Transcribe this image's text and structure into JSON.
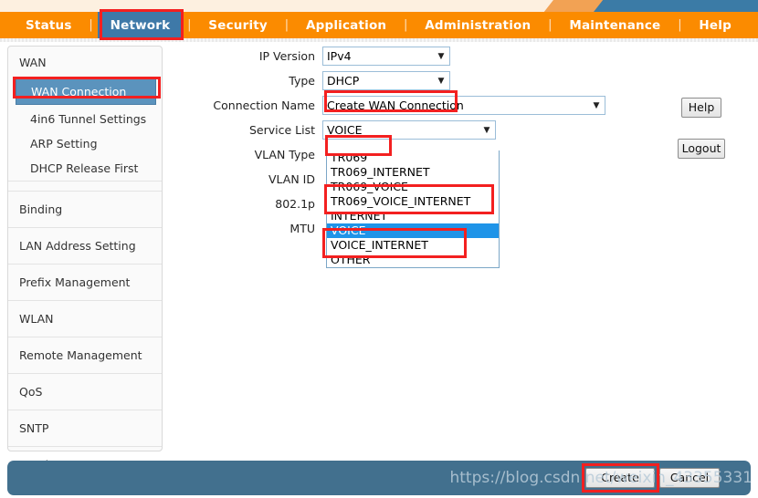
{
  "nav": {
    "separator": "|",
    "items": [
      {
        "label": "Status",
        "active": false
      },
      {
        "label": "Network",
        "active": true
      },
      {
        "label": "Security",
        "active": false
      },
      {
        "label": "Application",
        "active": false
      },
      {
        "label": "Administration",
        "active": false
      },
      {
        "label": "Maintenance",
        "active": false
      },
      {
        "label": "Help",
        "active": false
      }
    ]
  },
  "sidebar": {
    "group_title": "WAN",
    "sub_items": [
      {
        "label": "WAN Connection",
        "selected": true
      },
      {
        "label": "4in6 Tunnel Settings",
        "selected": false
      },
      {
        "label": "ARP Setting",
        "selected": false
      },
      {
        "label": "DHCP Release First",
        "selected": false
      }
    ],
    "items": [
      {
        "label": "Binding"
      },
      {
        "label": "LAN Address Setting"
      },
      {
        "label": "Prefix Management"
      },
      {
        "label": "WLAN"
      },
      {
        "label": "Remote Management"
      },
      {
        "label": "QoS"
      },
      {
        "label": "SNTP"
      },
      {
        "label": "Routing"
      }
    ]
  },
  "form": {
    "ip_version": {
      "label": "IP Version",
      "value": "IPv4"
    },
    "type": {
      "label": "Type",
      "value": "DHCP"
    },
    "connection_name": {
      "label": "Connection Name",
      "value": "Create WAN Connection"
    },
    "service_list": {
      "label": "Service List",
      "value": "VOICE"
    },
    "vlan_type": {
      "label": "VLAN Type"
    },
    "vlan_id": {
      "label": "VLAN ID"
    },
    "dot1p": {
      "label": "802.1p"
    },
    "mtu": {
      "label": "MTU"
    }
  },
  "dropdown": {
    "open": true,
    "options": [
      {
        "label": "TR069",
        "selected": false
      },
      {
        "label": "TR069_INTERNET",
        "selected": false
      },
      {
        "label": "TR069_VOICE",
        "selected": false
      },
      {
        "label": "TR069_VOICE_INTERNET",
        "selected": false
      },
      {
        "label": "INTERNET",
        "selected": false
      },
      {
        "label": "VOICE",
        "selected": true
      },
      {
        "label": "VOICE_INTERNET",
        "selected": false
      },
      {
        "label": "OTHER",
        "selected": false
      }
    ]
  },
  "buttons": {
    "help": "Help",
    "logout": "Logout",
    "create": "Create",
    "cancel": "Cancel"
  },
  "watermark": {
    "text": "https://blog.csdn.net/weixin_43355331"
  },
  "colors": {
    "nav_orange": "#fb8b00",
    "nav_active_blue": "#3e79a8",
    "highlight_red": "#f32020",
    "dropdown_selected_blue": "#1f94e8",
    "bottom_bar_blue": "#42708e",
    "sidebar_selected_blue": "#5b93bd"
  }
}
